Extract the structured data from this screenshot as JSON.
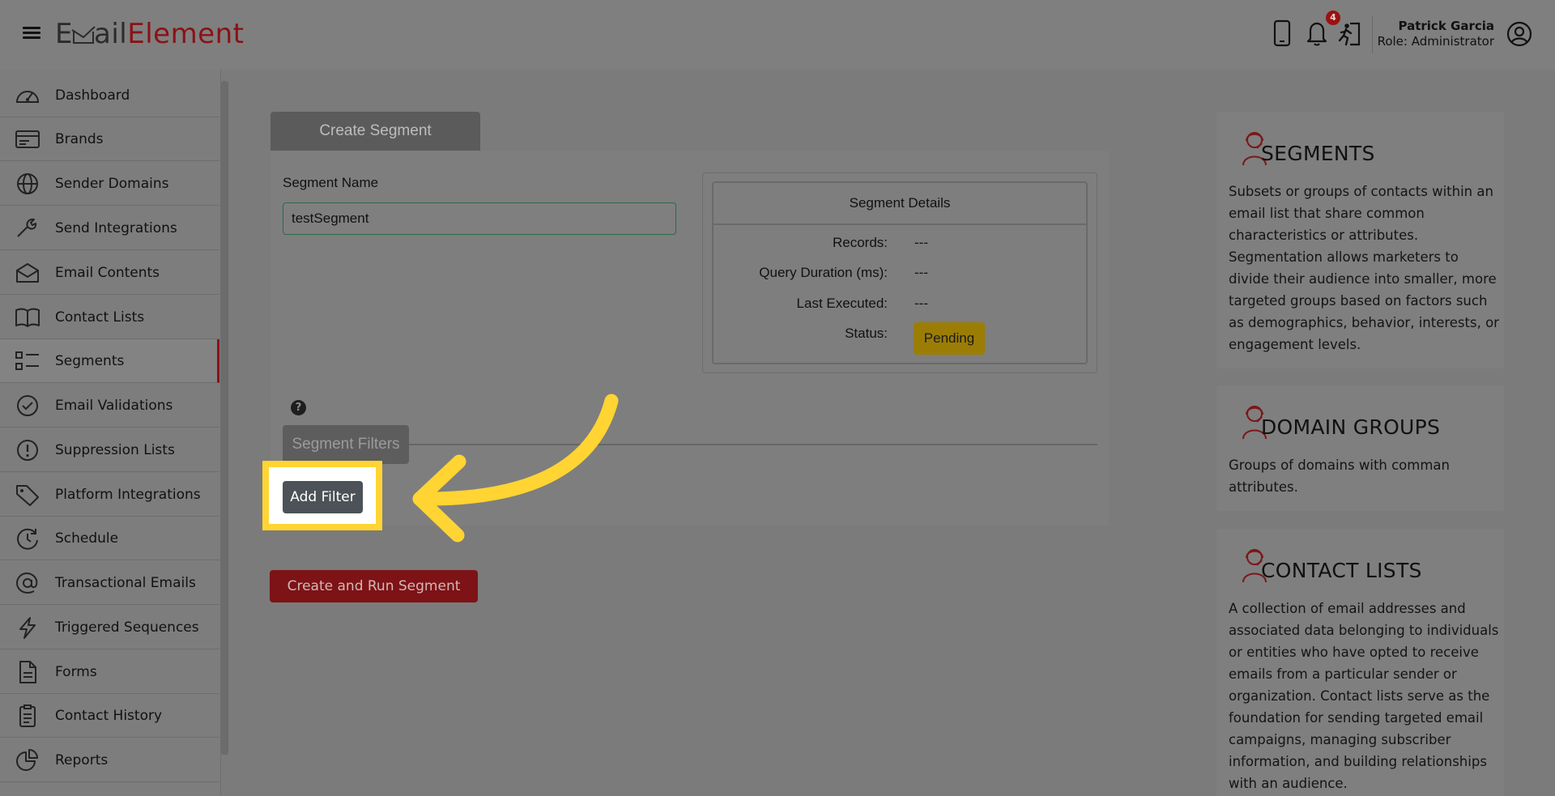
{
  "header": {
    "logo_part1": "E",
    "logo_part2": "ail",
    "logo_part3": "Element",
    "notification_count": "4",
    "user_name": "Patrick Garcia",
    "user_role": "Role: Administrator",
    "icons": [
      "phone-icon",
      "bell-icon",
      "logout-icon",
      "user-avatar-icon"
    ]
  },
  "sidebar": {
    "items": [
      {
        "label": "Dashboard",
        "icon": "gauge-icon"
      },
      {
        "label": "Brands",
        "icon": "card-icon"
      },
      {
        "label": "Sender Domains",
        "icon": "globe-icon"
      },
      {
        "label": "Send Integrations",
        "icon": "wrench-icon"
      },
      {
        "label": "Email Contents",
        "icon": "envelope-open-icon"
      },
      {
        "label": "Contact Lists",
        "icon": "book-icon"
      },
      {
        "label": "Segments",
        "icon": "list-icon"
      },
      {
        "label": "Email Validations",
        "icon": "check-circle-icon"
      },
      {
        "label": "Suppression Lists",
        "icon": "exclamation-circle-icon"
      },
      {
        "label": "Platform Integrations",
        "icon": "tag-icon"
      },
      {
        "label": "Schedule",
        "icon": "clock-icon"
      },
      {
        "label": "Transactional Emails",
        "icon": "at-icon"
      },
      {
        "label": "Triggered Sequences",
        "icon": "bolt-icon"
      },
      {
        "label": "Forms",
        "icon": "file-icon"
      },
      {
        "label": "Contact History",
        "icon": "clipboard-icon"
      },
      {
        "label": "Reports",
        "icon": "pie-chart-icon"
      }
    ],
    "active": "Segments"
  },
  "main": {
    "tab_label": "Create Segment",
    "segment_name_label": "Segment Name",
    "segment_name_value": "testSegment",
    "details": {
      "title": "Segment Details",
      "rows": [
        {
          "label": "Records:",
          "value": "---"
        },
        {
          "label": "Query Duration (ms):",
          "value": "---"
        },
        {
          "label": "Last Executed:",
          "value": "---"
        },
        {
          "label": "Status:",
          "value": "Pending"
        }
      ]
    },
    "help_glyph": "?",
    "filters_tab_label": "Segment Filters",
    "add_filter_label": "Add Filter",
    "run_button_label": "Create and Run Segment"
  },
  "cards": [
    {
      "title": "SEGMENTS",
      "description": "Subsets or groups of contacts within an email list that share common characteristics or attributes. Segmentation allows marketers to divide their audience into smaller, more targeted groups based on factors such as demographics, behavior, interests, or engagement levels."
    },
    {
      "title": "DOMAIN GROUPS",
      "description": "Groups of domains with comman attributes."
    },
    {
      "title": "CONTACT LISTS",
      "description": "A collection of email addresses and associated data belonging to individuals or entities who have opted to receive emails from a particular sender or organization. Contact lists serve as the foundation for sending targeted email campaigns, managing subscriber information, and building relationships with an audience."
    }
  ],
  "colors": {
    "brand_red": "#8a1216",
    "highlight_yellow": "#ffd433",
    "pending_badge": "#9b7d06",
    "overlay_gray": "#7b7b7b"
  }
}
